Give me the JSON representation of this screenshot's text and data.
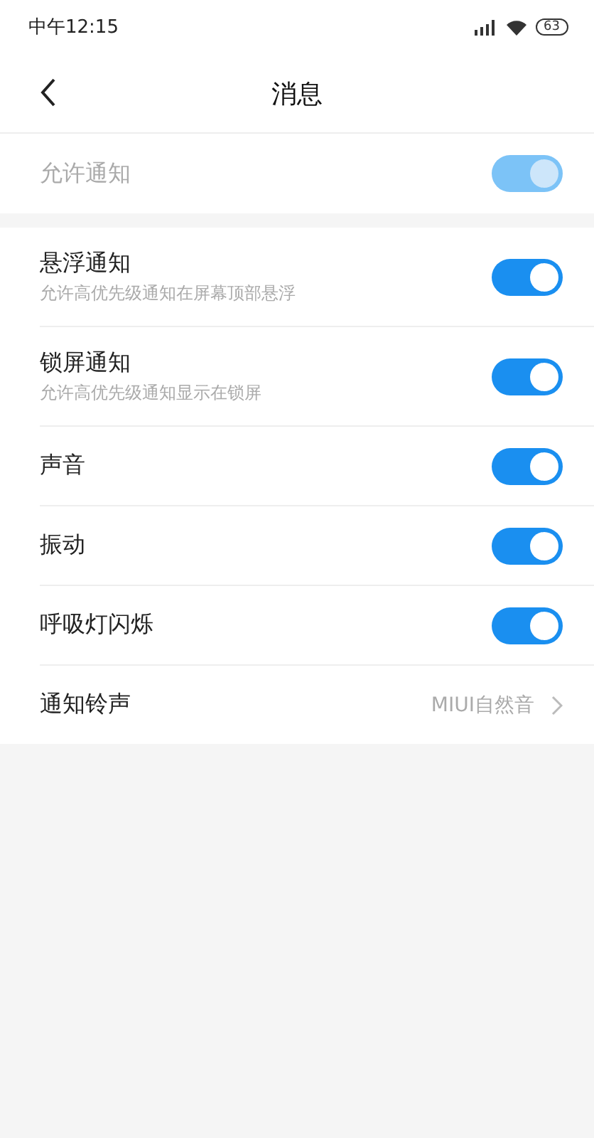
{
  "status_bar": {
    "time": "中午12:15",
    "battery": "63"
  },
  "header": {
    "title": "消息"
  },
  "master": {
    "label": "允许通知",
    "on": true,
    "disabled": true
  },
  "rows": [
    {
      "kind": "toggle",
      "label": "悬浮通知",
      "subtitle": "允许高优先级通知在屏幕顶部悬浮",
      "on": true
    },
    {
      "kind": "toggle",
      "label": "锁屏通知",
      "subtitle": "允许高优先级通知显示在锁屏",
      "on": true
    },
    {
      "kind": "toggle",
      "label": "声音",
      "on": true
    },
    {
      "kind": "toggle",
      "label": "振动",
      "on": true
    },
    {
      "kind": "toggle",
      "label": "呼吸灯闪烁",
      "on": true
    },
    {
      "kind": "link",
      "label": "通知铃声",
      "value": "MIUI自然音"
    }
  ]
}
